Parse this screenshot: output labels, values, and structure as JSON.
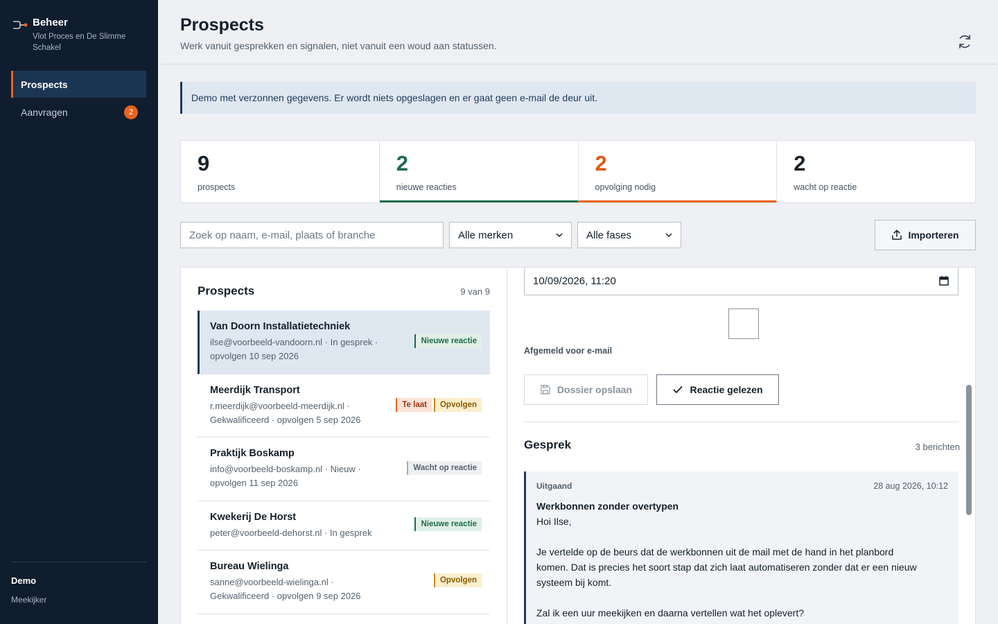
{
  "brand": {
    "title": "Beheer",
    "subtitle": "Vlot Proces en De Slimme Schakel"
  },
  "sidebar": {
    "items": [
      {
        "label": "Prospects",
        "active": true
      },
      {
        "label": "Aanvragen",
        "badge": "2"
      }
    ],
    "user": {
      "name": "Demo",
      "role": "Meekijker"
    }
  },
  "header": {
    "title": "Prospects",
    "subtitle": "Werk vanuit gesprekken en signalen, niet vanuit een woud aan statussen."
  },
  "banner": "Demo met verzonnen gegevens. Er wordt niets opgeslagen en er gaat geen e-mail de deur uit.",
  "stats": [
    {
      "value": "9",
      "label": "prospects"
    },
    {
      "value": "2",
      "label": "nieuwe reacties"
    },
    {
      "value": "2",
      "label": "opvolging nodig"
    },
    {
      "value": "2",
      "label": "wacht op reactie"
    }
  ],
  "filters": {
    "search_placeholder": "Zoek op naam, e-mail, plaats of branche",
    "brand_select": "Alle merken",
    "phase_select": "Alle fases",
    "import_label": "Importeren"
  },
  "list": {
    "title": "Prospects",
    "count": "9 van 9",
    "rows": [
      {
        "name": "Van Doorn Installatietechniek",
        "meta": "ilse@voorbeeld-vandoorn.nl · In gesprek · opvolgen 10 sep 2026",
        "tags": [
          {
            "label": "Nieuwe reactie",
            "kind": "new"
          }
        ]
      },
      {
        "name": "Meerdijk Transport",
        "meta": "r.meerdijk@voorbeeld-meerdijk.nl · Gekwalificeerd · opvolgen 5 sep 2026",
        "tags": [
          {
            "label": "Te laat",
            "kind": "late"
          },
          {
            "label": "Opvolgen",
            "kind": "follow"
          }
        ]
      },
      {
        "name": "Praktijk Boskamp",
        "meta": "info@voorbeeld-boskamp.nl · Nieuw · opvolgen 11 sep 2026",
        "tags": [
          {
            "label": "Wacht op reactie",
            "kind": "wait"
          }
        ]
      },
      {
        "name": "Kwekerij De Horst",
        "meta": "peter@voorbeeld-dehorst.nl · In gesprek",
        "tags": [
          {
            "label": "Nieuwe reactie",
            "kind": "new"
          }
        ]
      },
      {
        "name": "Bureau Wielinga",
        "meta": "sanne@voorbeeld-wielinga.nl · Gekwalificeerd · opvolgen 9 sep 2026",
        "tags": [
          {
            "label": "Opvolgen",
            "kind": "follow"
          }
        ]
      }
    ]
  },
  "detail": {
    "datetime_value": "10/09/2026, 11:20",
    "optout_label": "Afgemeld voor e-mail",
    "save_label": "Dossier opslaan",
    "read_label": "Reactie gelezen",
    "conversation_title": "Gesprek",
    "conversation_count": "3 berichten",
    "message": {
      "direction": "Uitgaand",
      "date": "28 aug 2026, 10:12",
      "subject": "Werkbonnen zonder overtypen",
      "body": "Hoi Ilse,\n\nJe vertelde op de beurs dat de werkbonnen uit de mail met de hand in het planbord komen. Dat is precies het soort stap dat zich laat automatiseren zonder dat er een nieuw systeem bij komt.\n\nZal ik een uur meekijken en daarna vertellen wat het oplevert?"
    }
  }
}
